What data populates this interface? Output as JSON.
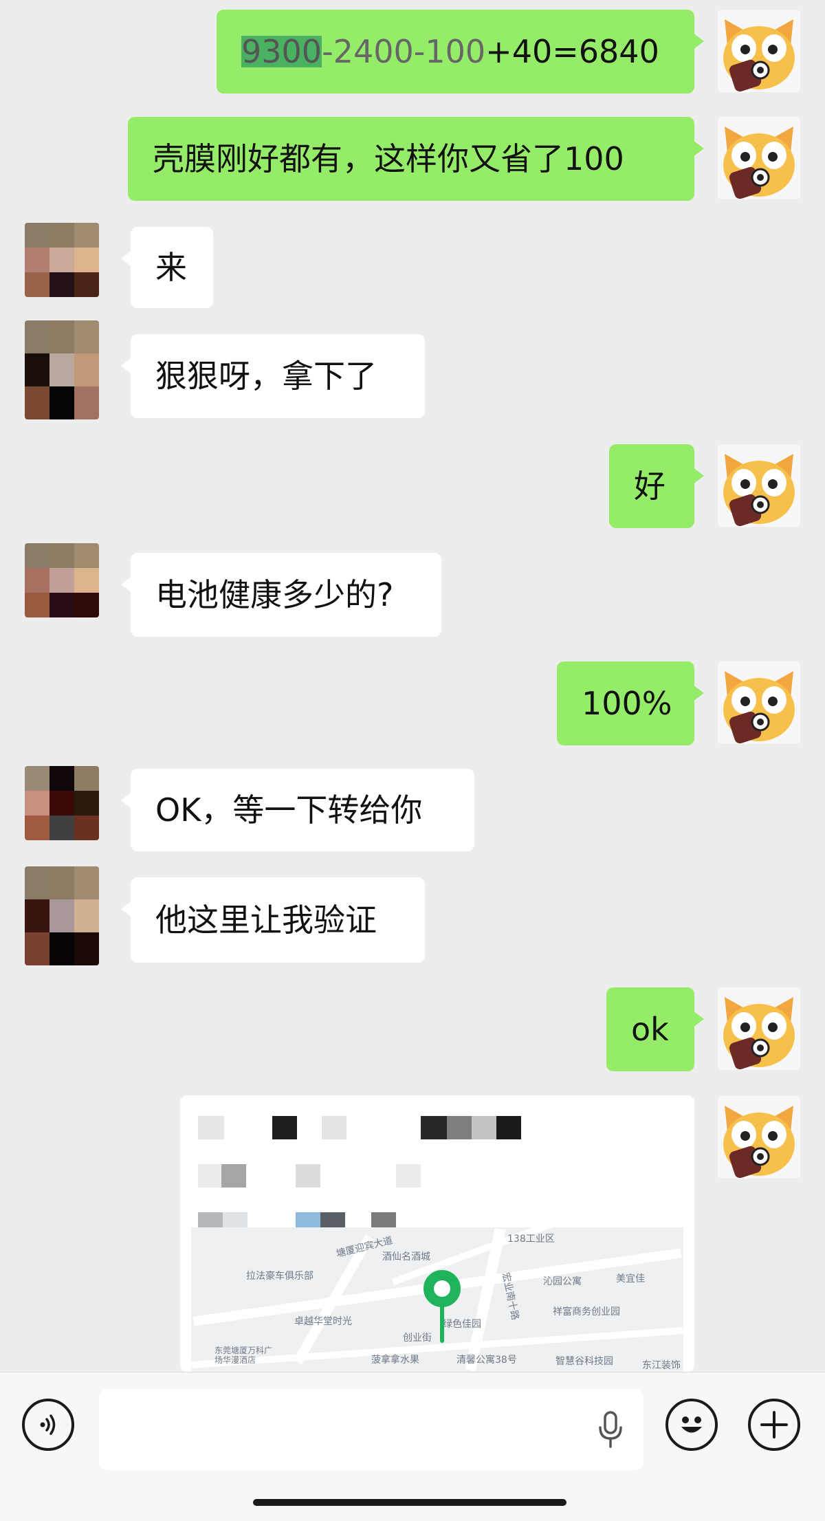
{
  "messages": [
    {
      "side": "me",
      "text_parts": [
        "9300",
        "-2400-100",
        "+40=6840"
      ]
    },
    {
      "side": "me",
      "text": "壳膜刚好都有，这样你又省了100"
    },
    {
      "side": "them",
      "text": "来"
    },
    {
      "side": "them",
      "text": "狠狠呀，拿下了"
    },
    {
      "side": "me",
      "text": "好"
    },
    {
      "side": "them",
      "text": "电池健康多少的?"
    },
    {
      "side": "me",
      "text": "100%"
    },
    {
      "side": "them",
      "text": "OK，等一下转给你"
    },
    {
      "side": "them",
      "text": "他这里让我验证"
    },
    {
      "side": "me",
      "text": "ok"
    }
  ],
  "location_card": {
    "map_labels": [
      "138工业区",
      "酒仙名酒城",
      "拉法豪车俱乐部",
      "卓越华堂时光",
      "沁园公寓",
      "美宜佳",
      "祥富商务创业园",
      "绿色佳园",
      "清馨公寓38号",
      "智慧谷科技园",
      "东莞塘厦万科广场华漫酒店",
      "菠拿拿水果",
      "东江装饰",
      "创业街",
      "塘厦迎宾大道",
      "宏业南十路"
    ]
  },
  "input_bar": {
    "voice_icon": "voice-icon",
    "mic_icon": "microphone-icon",
    "emoji_icon": "emoji-icon",
    "plus_icon": "plus-icon"
  },
  "colors": {
    "sent_bubble": "#95ec69",
    "received_bubble": "#ffffff",
    "background": "#ededed",
    "pin": "#1fb35b"
  }
}
